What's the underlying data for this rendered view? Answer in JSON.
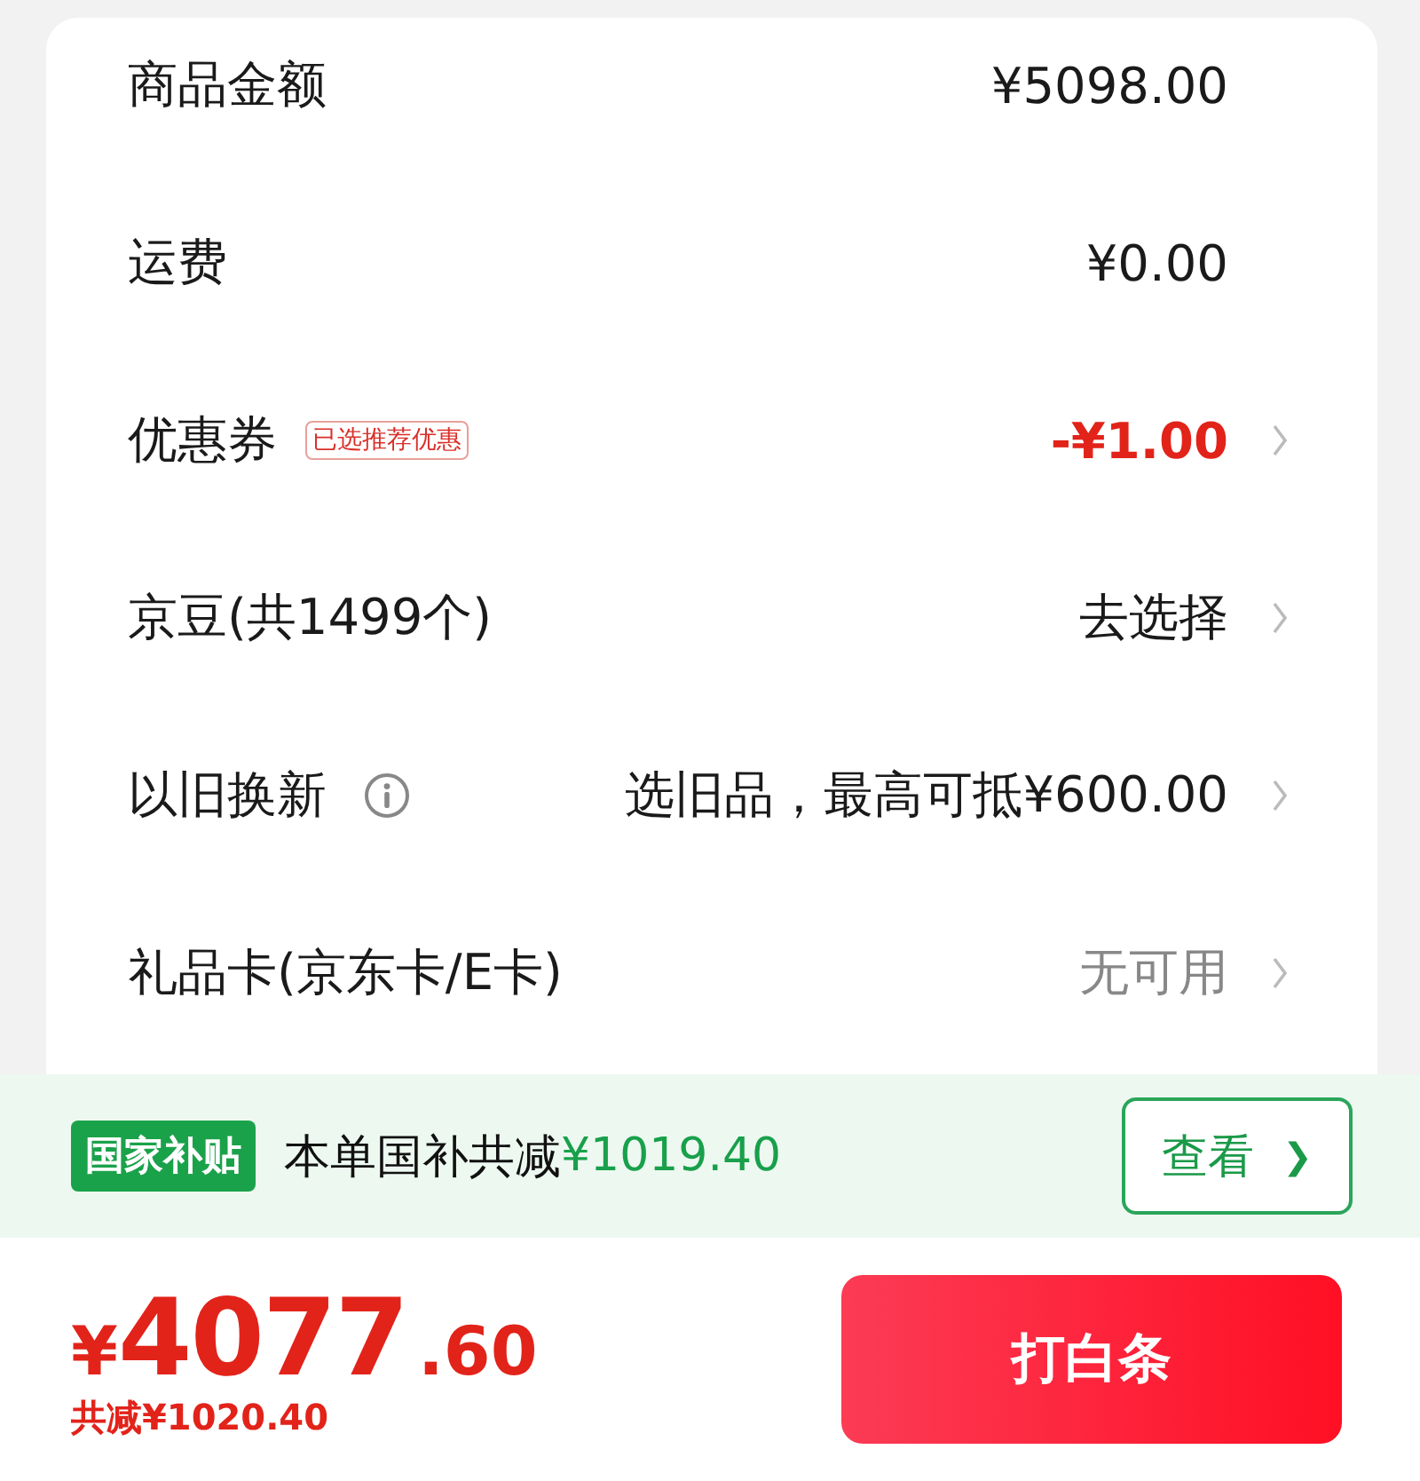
{
  "summary": {
    "rows": [
      {
        "label": "商品金额",
        "value": "¥5098.00",
        "kind": "plain",
        "chevron": false
      },
      {
        "label": "运费",
        "value": "¥0.00",
        "kind": "plain",
        "chevron": false
      },
      {
        "label": "优惠券",
        "tag": "已选推荐优惠",
        "value": "-¥1.00",
        "kind": "discount",
        "chevron": true
      },
      {
        "label": "京豆(共1499个)",
        "value": "去选择",
        "kind": "plain",
        "chevron": true
      },
      {
        "label": "以旧换新",
        "info": true,
        "value": "选旧品，最高可抵¥600.00",
        "kind": "plain",
        "chevron": true
      },
      {
        "label": "礼品卡(京东卡/E卡)",
        "value": "无可用",
        "kind": "muted",
        "chevron": true
      }
    ]
  },
  "subsidy": {
    "badge": "国家补贴",
    "text": "本单国补共减",
    "amount": "¥1019.40",
    "button": "查看",
    "button_icon": "❯"
  },
  "checkout": {
    "currency": "¥",
    "price_integer": "4077",
    "price_decimal": ".60",
    "saved": "共减¥1020.40",
    "button": "打白条"
  }
}
